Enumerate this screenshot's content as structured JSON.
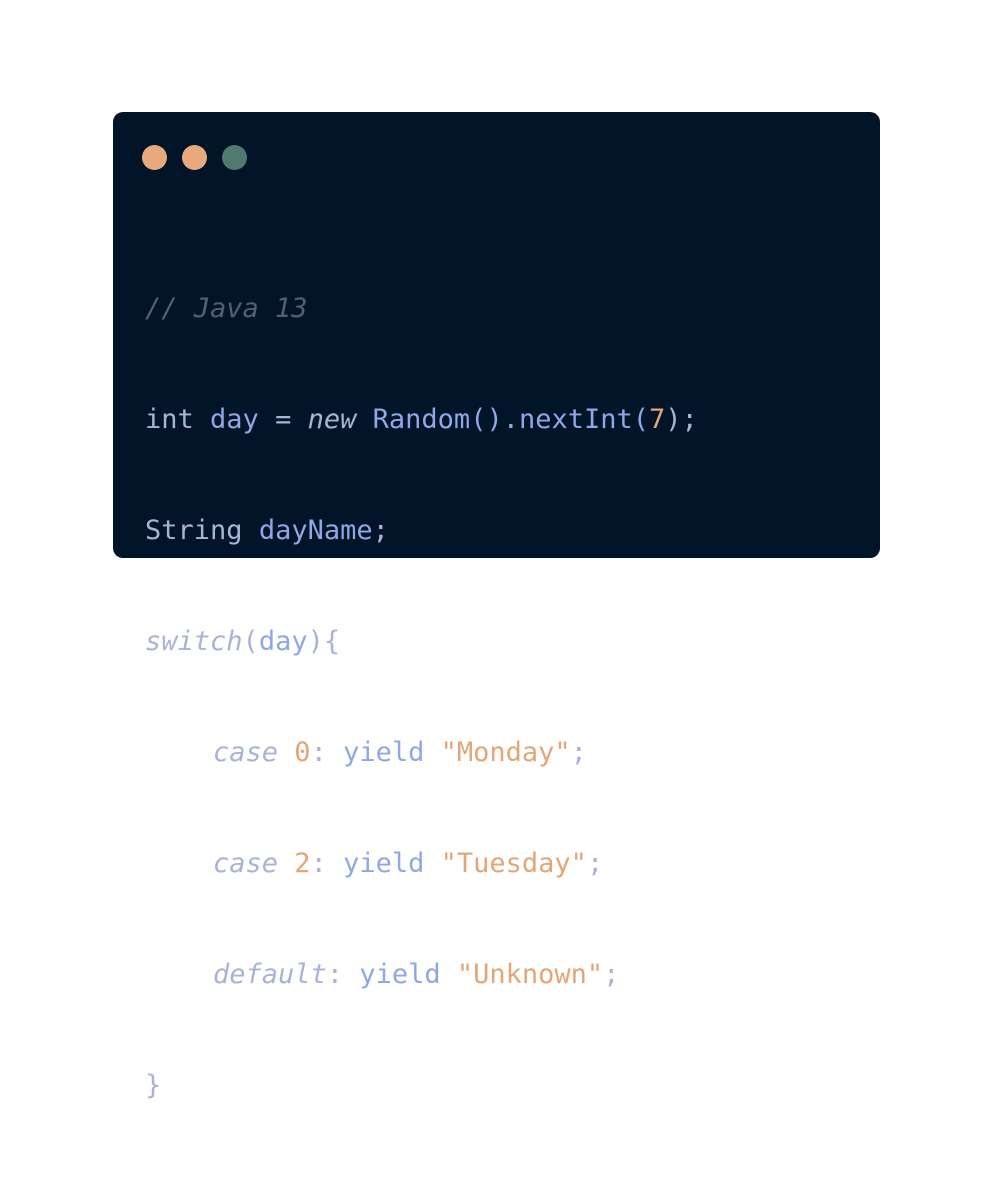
{
  "window": {
    "dots": [
      {
        "name": "close-dot",
        "color": "#e8aa7c"
      },
      {
        "name": "minimize-dot",
        "color": "#e8aa7c"
      },
      {
        "name": "maximize-dot",
        "color": "#4e7a6f"
      }
    ]
  },
  "code": {
    "line1": {
      "comment": "// Java 13"
    },
    "line2": {
      "kw": "int",
      "var": "day",
      "eq": " = ",
      "new": "new",
      "cls": "Random",
      "call": "().nextInt(",
      "num": "7",
      "end": ");"
    },
    "line3": {
      "type": "String",
      "var": "dayName",
      "end": ";"
    },
    "line4": {
      "kw": "switch",
      "open": "(",
      "var": "day",
      "close": "){"
    },
    "line5": {
      "kw": "case",
      "num": "0",
      "colon": ": ",
      "yield": "yield",
      "str": "\"Monday\"",
      "end": ";"
    },
    "line6": {
      "kw": "case",
      "num": "2",
      "colon": ": ",
      "yield": "yield",
      "str": "\"Tuesday\"",
      "end": ";"
    },
    "line7": {
      "kw": "default",
      "colon": ": ",
      "yield": "yield",
      "str": "\"Unknown\"",
      "end": ";"
    },
    "line8": {
      "brace": "}"
    }
  }
}
